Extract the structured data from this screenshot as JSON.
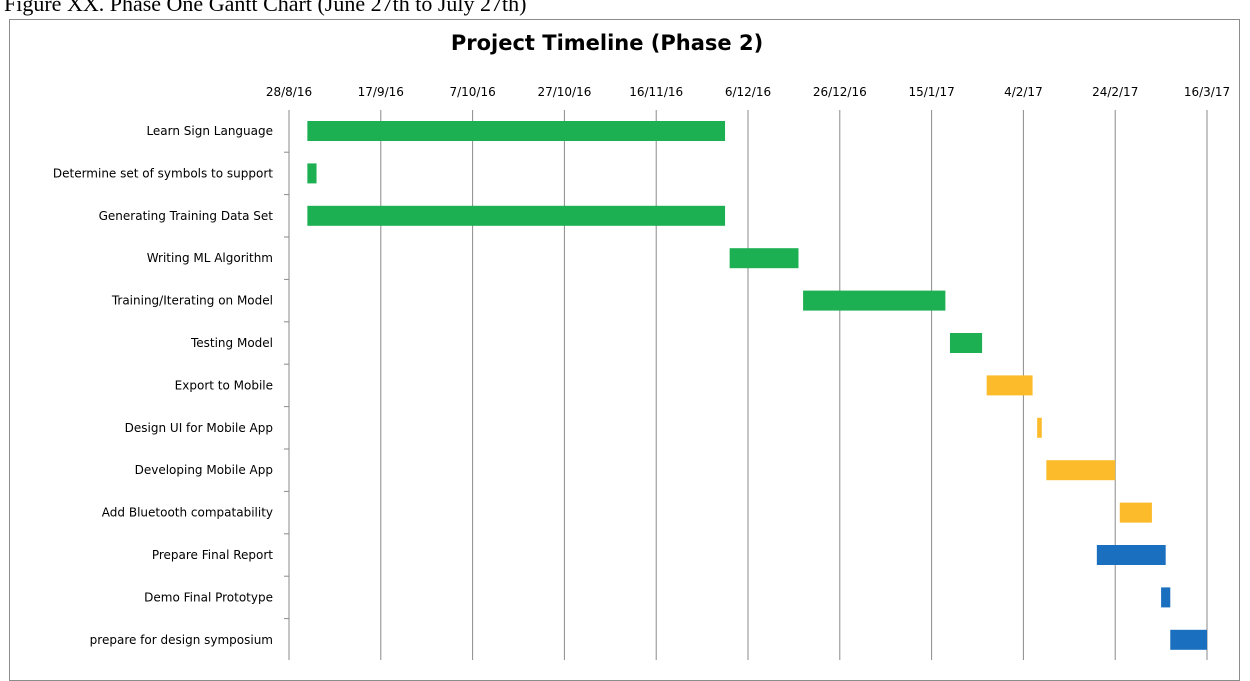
{
  "caption": "Figure XX. Phase One Gantt Chart (June 27th to July 27th)",
  "chart_data": {
    "type": "gantt",
    "title": "Project Timeline (Phase 2)",
    "x_start": "2016-08-28",
    "x_end": "2017-03-16",
    "x_ticks": [
      "28/8/16",
      "17/9/16",
      "7/10/16",
      "27/10/16",
      "16/11/16",
      "6/12/16",
      "26/12/16",
      "15/1/17",
      "4/2/17",
      "24/2/17",
      "16/3/17"
    ],
    "grid": true,
    "colors": {
      "green": "#1db052",
      "yellow": "#fbbb2a",
      "blue": "#1a6fbf"
    },
    "tasks": [
      {
        "name": "Learn Sign Language",
        "start": "2016-09-01",
        "end": "2016-12-01",
        "color": "green"
      },
      {
        "name": "Determine set of symbols to support",
        "start": "2016-09-01",
        "end": "2016-09-03",
        "color": "green"
      },
      {
        "name": "Generating Training Data Set",
        "start": "2016-09-01",
        "end": "2016-12-01",
        "color": "green"
      },
      {
        "name": "Writing ML Algorithm",
        "start": "2016-12-02",
        "end": "2016-12-17",
        "color": "green"
      },
      {
        "name": "Training/Iterating on Model",
        "start": "2016-12-18",
        "end": "2017-01-18",
        "color": "green"
      },
      {
        "name": "Testing Model",
        "start": "2017-01-19",
        "end": "2017-01-26",
        "color": "green"
      },
      {
        "name": "Export to Mobile",
        "start": "2017-01-27",
        "end": "2017-02-06",
        "color": "yellow"
      },
      {
        "name": "Design UI for Mobile App",
        "start": "2017-02-07",
        "end": "2017-02-08",
        "color": "yellow"
      },
      {
        "name": "Developing Mobile App",
        "start": "2017-02-09",
        "end": "2017-02-24",
        "color": "yellow"
      },
      {
        "name": "Add Bluetooth compatability",
        "start": "2017-02-25",
        "end": "2017-03-04",
        "color": "yellow"
      },
      {
        "name": "Prepare Final Report",
        "start": "2017-02-20",
        "end": "2017-03-07",
        "color": "blue"
      },
      {
        "name": "Demo Final Prototype",
        "start": "2017-03-06",
        "end": "2017-03-08",
        "color": "blue"
      },
      {
        "name": "prepare for design symposium",
        "start": "2017-03-08",
        "end": "2017-03-16",
        "color": "blue"
      }
    ]
  }
}
